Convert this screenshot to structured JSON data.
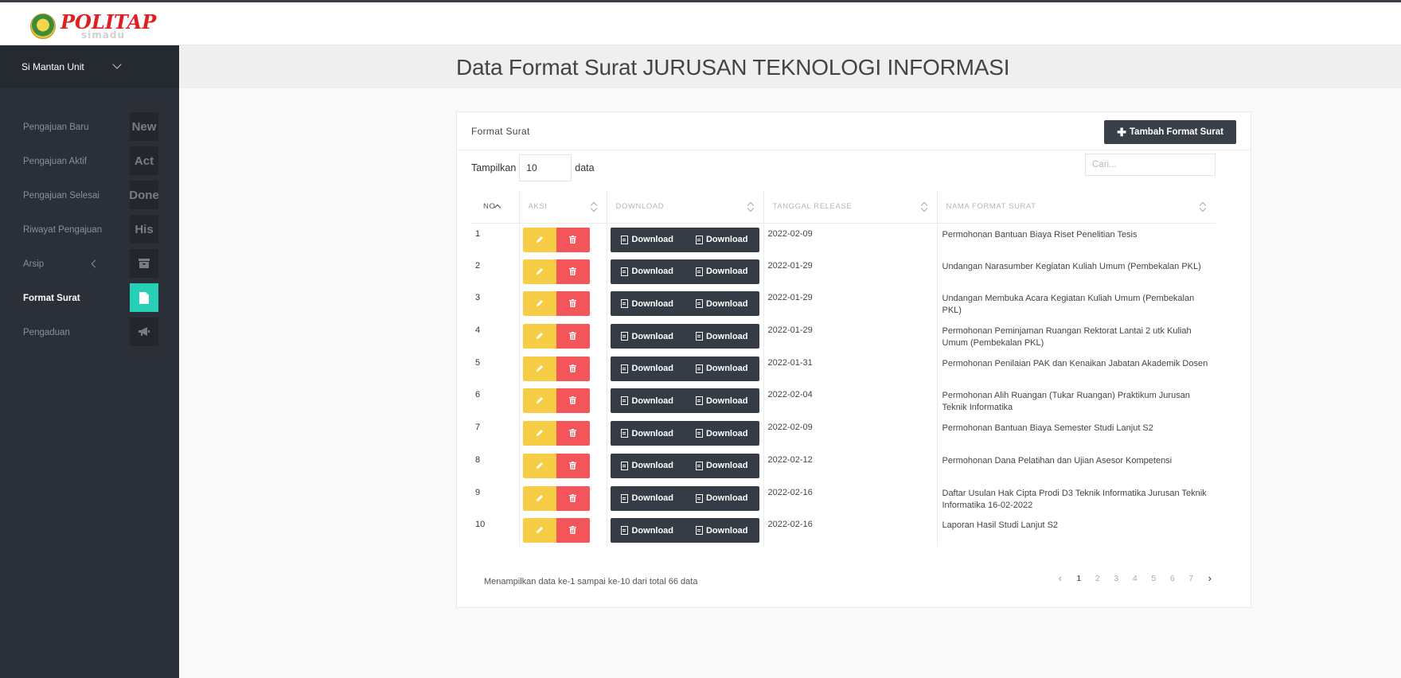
{
  "logo": {
    "main": "POLITAP",
    "sub": "simadu"
  },
  "sidebar": {
    "unit_label": "Si Mantan Unit",
    "items": [
      {
        "label": "Pengajuan Baru",
        "badge": "New"
      },
      {
        "label": "Pengajuan Aktif",
        "badge": "Act"
      },
      {
        "label": "Pengajuan Selesai",
        "badge": "Done"
      },
      {
        "label": "Riwayat Pengajuan",
        "badge": "His"
      },
      {
        "label": "Arsip",
        "badge": ""
      },
      {
        "label": "Format Surat",
        "badge": ""
      },
      {
        "label": "Pengaduan",
        "badge": ""
      }
    ]
  },
  "page": {
    "title": "Data Format Surat JURUSAN TEKNOLOGI INFORMASI"
  },
  "panel": {
    "title": "Format Surat",
    "add_label": "Tambah Format Surat",
    "show_label": "Tampilkan",
    "show_value": "10",
    "data_label": "data",
    "search_placeholder": "Cari..."
  },
  "table": {
    "headers": [
      "NO",
      "AKSI",
      "DOWNLOAD",
      "TANGGAL RELEASE",
      "NAMA FORMAT SURAT"
    ],
    "download_label": "Download",
    "rows": [
      {
        "no": "1",
        "date": "2022-02-09",
        "name": "Permohonan Bantuan Biaya Riset Penelitian Tesis"
      },
      {
        "no": "2",
        "date": "2022-01-29",
        "name": "Undangan Narasumber Kegiatan Kuliah Umum (Pembekalan PKL)"
      },
      {
        "no": "3",
        "date": "2022-01-29",
        "name": "Undangan Membuka Acara Kegiatan Kuliah Umum (Pembekalan PKL)"
      },
      {
        "no": "4",
        "date": "2022-01-29",
        "name": "Permohonan Peminjaman Ruangan Rektorat Lantai 2 utk Kuliah Umum (Pembekalan PKL)"
      },
      {
        "no": "5",
        "date": "2022-01-31",
        "name": "Permohonan Penilaian PAK dan Kenaikan Jabatan Akademik Dosen"
      },
      {
        "no": "6",
        "date": "2022-02-04",
        "name": "Permohonan Alih Ruangan (Tukar Ruangan) Praktikum Jurusan Teknik Informatika"
      },
      {
        "no": "7",
        "date": "2022-02-09",
        "name": "Permohonan Bantuan Biaya Semester Studi Lanjut S2"
      },
      {
        "no": "8",
        "date": "2022-02-12",
        "name": "Permohonan Dana Pelatihan dan Ujian Asesor Kompetensi"
      },
      {
        "no": "9",
        "date": "2022-02-16",
        "name": "Daftar Usulan Hak Cipta Prodi D3 Teknik Informatika Jurusan Teknik Informatika 16-02-2022"
      },
      {
        "no": "10",
        "date": "2022-02-16",
        "name": "Laporan Hasil Studi Lanjut S2"
      }
    ]
  },
  "footer": {
    "info": "Menampilkan data ke-1 sampai ke-10 dari total 66 data",
    "pages": [
      "1",
      "2",
      "3",
      "4",
      "5",
      "6",
      "7"
    ],
    "prev": "‹",
    "next": "›"
  }
}
